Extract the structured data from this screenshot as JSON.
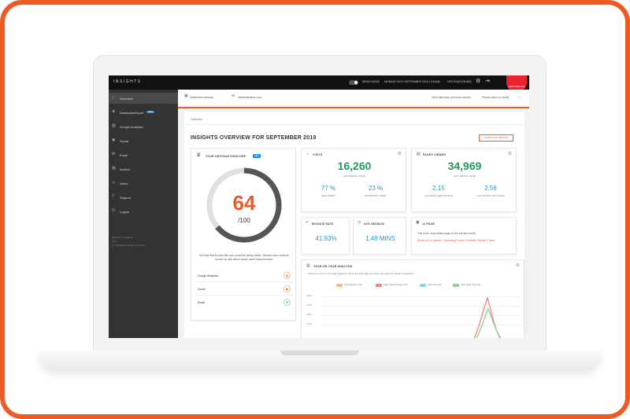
{
  "app": {
    "logo_text": "INSIGHTS",
    "topbar": {
      "toggle_label": "DEMO MODE",
      "date_text": "MONDAY 30TH SEPTEMBER 2019 | 9:51AM",
      "account_text": "DESTINATION ABC",
      "brand_badge": "DESTINATION"
    },
    "sidebar": {
      "items": [
        {
          "icon": "home-icon",
          "glyph": "⌂",
          "label": "Overview",
          "active": true
        },
        {
          "icon": "trophy-icon",
          "glyph": "♛",
          "label": "DestinationScore",
          "badge": "NEW"
        },
        {
          "icon": "analytics-icon",
          "glyph": "▥",
          "label": "Google Analytics"
        },
        {
          "icon": "social-icon",
          "glyph": "◉",
          "label": "Social"
        },
        {
          "icon": "email-icon",
          "glyph": "✉",
          "label": "Email"
        },
        {
          "icon": "archive-icon",
          "glyph": "▤",
          "label": "Archive"
        },
        {
          "icon": "users-icon",
          "glyph": "☺",
          "label": "Users"
        },
        {
          "icon": "support-icon",
          "glyph": "?",
          "label": "Support"
        },
        {
          "icon": "logout-icon",
          "glyph": "⏻",
          "label": "Logout"
        }
      ],
      "footer_lines": [
        "Destination Insights",
        "v2.0",
        "© Simpleview Europe Ltd 2019"
      ]
    },
    "subbar": {
      "site_name": "Destination Abroad",
      "site_url": "visitdestination.com",
      "compare_text": "View data from previous months",
      "month_select": "Please select a month"
    },
    "breadcrumb": "Overview",
    "page_title": "INSIGHTS OVERVIEW FOR SEPTEMBER 2019",
    "download_label": "DOWNLOAD REPORT",
    "score_card": {
      "title": "YOUR DESTINATIONSCORE",
      "badge": "NEW",
      "score": "64",
      "out_of": "/100",
      "help_text": "Not bad but it looks like you could be doing better. Review your channel scores to see which areas need improvement.",
      "rows": [
        {
          "label": "Google Analytics",
          "glyph": "▥",
          "color": "#ef5a24"
        },
        {
          "label": "Social",
          "glyph": "◉",
          "color": "#ef5a24"
        },
        {
          "label": "Email",
          "glyph": "✉",
          "color": "#1e9c5c"
        }
      ],
      "score_fraction": 0.64,
      "colors": {
        "track": "#e0e0e0",
        "fill": "#555555",
        "number": "#ef5a24"
      }
    },
    "visits": {
      "title": "VISITS",
      "value": "16,260",
      "last_month": "LAST MONTH: 15,079",
      "stat1_value": "77 %",
      "stat1_label": "NEW USERS",
      "stat2_value": "23 %",
      "stat2_label": "RETURNING USERS"
    },
    "pages_viewed": {
      "title": "PAGES VIEWED",
      "value": "34,969",
      "last_month": "LAST MONTH: 30,489",
      "stat1_value": "2.15",
      "stat1_label": "AVG PAGES PER SESSION",
      "stat2_value": "2.56",
      "stat2_label": "LAST MONTH: AVG PAGES"
    },
    "bounce_rate": {
      "title": "BOUNCE RATE",
      "value": "41.93%"
    },
    "avg_session": {
      "title": "AVG SESSION",
      "value": "1.48 MINS"
    },
    "top_page": {
      "title": "#1 PAGE",
      "text": "This is the most visited page on the site this month",
      "link": "What's On In Ipswich - Upcoming Events, Festivals, Shows & Tours"
    },
    "yoy": {
      "title": "YEAR-ON-YEAR ANALYSIS",
      "subtitle": "Click on an item in the chart legend to show and hide data and hover the graph for easier comparison",
      "legend": [
        {
          "label": "Visits Previous Year",
          "color": "#f5b98c"
        },
        {
          "label": "Page Views Previous Year",
          "color": "#f08a8a"
        },
        {
          "label": "Visits This Year",
          "color": "#8fd4ea"
        },
        {
          "label": "Page Views This Year",
          "color": "#8ed39a"
        }
      ],
      "ticks": [
        "40000",
        "35000",
        "30000",
        "25000"
      ]
    },
    "colors": {
      "accent": "#ef5a24",
      "green": "#1e9c5c",
      "teal": "#1a9bc7",
      "sidebar": "#333333",
      "topbar": "#111111"
    }
  }
}
